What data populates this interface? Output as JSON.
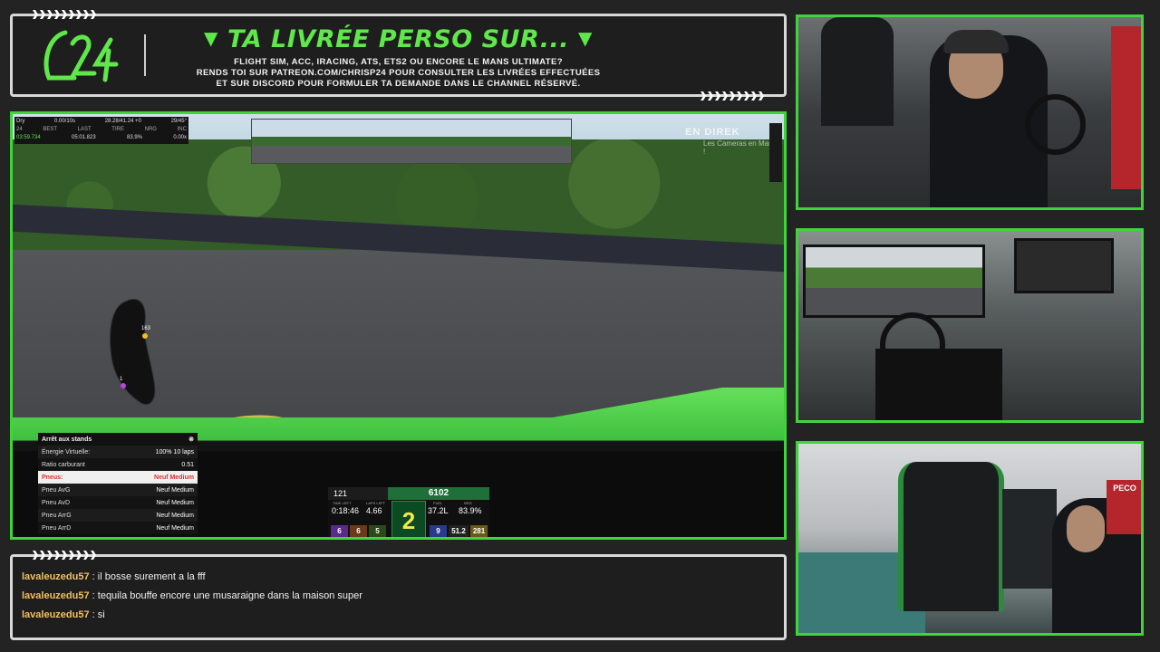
{
  "banner": {
    "title": "TA LIVRÉE PERSO SUR...",
    "line1": "FLIGHT SIM, ACC, IRACING, ATS, ETS2 OU ENCORE LE MANS ULTIMATE?",
    "line2": "RENDS TOI SUR PATREON.COM/CHRISP24 POUR CONSULTER LES LIVRÉES EFFECTUÉES",
    "line3": "ET SUR DISCORD POUR FORMULER TA DEMANDE DANS LE CHANNEL RÉSERVÉ.",
    "accent_color": "#5fe84a"
  },
  "game": {
    "live_label": "EN DIREK",
    "live_sub": "Les Cameras en Marche !",
    "topstats": {
      "weather": "Dry",
      "delta": "0.00/10s",
      "temps": "28.28/41.24 +0",
      "count": "29/45°",
      "pos": "24",
      "best_label": "BEST",
      "last_label": "LAST",
      "tire_label": "TIRE",
      "nrg_label": "NRG",
      "inc_label": "INC",
      "best": "03:59.734",
      "last": "05:01.823",
      "nrg": "83.9%",
      "inc": "0.00x"
    },
    "minimap": {
      "label_top": "163",
      "label_bottom": "1"
    },
    "pit_menu": {
      "title": "Arrêt aux stands",
      "rows": [
        {
          "label": "Énergie Virtuelle:",
          "value": "100% 10 laps"
        },
        {
          "label": "Ratio carburant",
          "value": "0.51"
        },
        {
          "label": "Pneus:",
          "value": "Neuf Medium"
        },
        {
          "label": "Pneu AvG",
          "value": "Neuf Medium"
        },
        {
          "label": "Pneu AvD",
          "value": "Neuf Medium"
        },
        {
          "label": "Pneu ArrG",
          "value": "Neuf Medium"
        },
        {
          "label": "Pneu ArrD",
          "value": "Neuf Medium"
        }
      ]
    },
    "hud": {
      "speed": "121",
      "rpm": "6102",
      "time_label": "TIME LEFT",
      "time_left": "0:18:46",
      "laps_label": "LAPS LEFT",
      "laps_left": "4.66",
      "gear": "2",
      "fuel_label": "FUEL",
      "fuel": "37.2L",
      "nrg_label": "NRG",
      "nrg": "83.9%",
      "tc1_label": "TC1",
      "tc1": "6",
      "tc2_label": "TC2",
      "tc2": "6",
      "tc3_label": "TC3",
      "tc3": "5",
      "abs_label": "ABS",
      "abs": "9",
      "bb_label": "BB",
      "bb": "51.2",
      "top_label": "TOP",
      "top": "281"
    }
  },
  "chat": {
    "messages": [
      {
        "user": "lavaleuzedu57",
        "text": ": il bosse surement a la fff"
      },
      {
        "user": "lavaleuzedu57",
        "text": ": tequila bouffe encore une musaraigne dans la maison super"
      },
      {
        "user": "lavaleuzedu57",
        "text": ": si"
      }
    ],
    "user_color": "#f2c060"
  },
  "cams": {
    "cam3_sign": "PECO"
  },
  "colors": {
    "frame_green": "#3fd43a",
    "frame_white": "#d9d9d9",
    "background": "#232323"
  }
}
